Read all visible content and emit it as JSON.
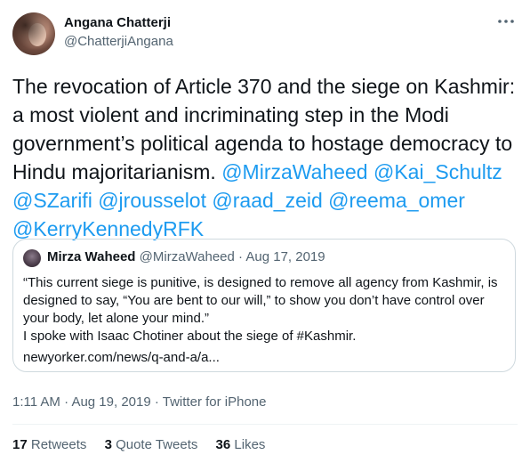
{
  "author": {
    "display_name": "Angana Chatterji",
    "handle": "@ChatterjiAngana"
  },
  "more_icon": "more-horizontal-icon",
  "tweet": {
    "text_parts": [
      "The revocation of Article 370 and the siege on Kashmir: a most violent and incriminating step in the Modi government’s political agenda to hostage democracy to Hindu majoritarianism. "
    ],
    "mentions": [
      "@MirzaWaheed",
      "@Kai_Schultz",
      "@SZarifi",
      "@jrousselot",
      "@raad_zeid",
      "@reema_omer",
      "@KerryKennedyRFK"
    ]
  },
  "quote": {
    "display_name": "Mirza Waheed",
    "handle": "@MirzaWaheed",
    "separator": "·",
    "date": "Aug 17, 2019",
    "body_line1": "“This current siege is punitive, is designed to remove all agency from Kashmir, is designed to say, “You are bent to our will,” to show you don’t have control over your body, let alone your mind.”",
    "body_line2": "I spoke with Isaac Chotiner about the siege of #Kashmir.",
    "link": "newyorker.com/news/q-and-a/a..."
  },
  "meta": {
    "time": "1:11 AM",
    "sep1": "·",
    "date": "Aug 19, 2019",
    "sep2": "·",
    "source": "Twitter for iPhone"
  },
  "stats": {
    "retweets_count": "17",
    "retweets_label": "Retweets",
    "quotes_count": "3",
    "quotes_label": "Quote Tweets",
    "likes_count": "36",
    "likes_label": "Likes"
  }
}
